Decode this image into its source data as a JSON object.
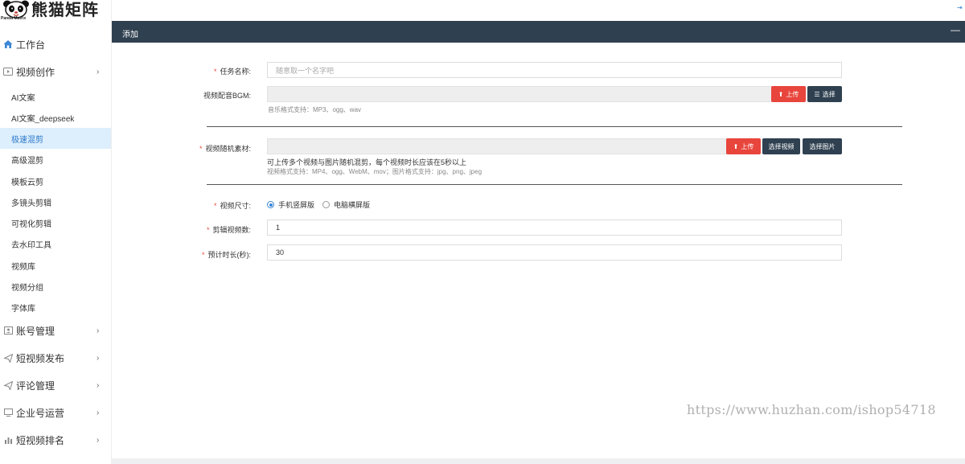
{
  "brand": {
    "name": "熊猫矩阵",
    "sub": "Panda Matrix"
  },
  "sidebar": {
    "items": [
      {
        "label": "工作台",
        "icon": "home-icon"
      },
      {
        "label": "视频创作",
        "icon": "video-icon",
        "expanded": true,
        "children": [
          {
            "label": "AI文案"
          },
          {
            "label": "AI文案_deepseek"
          },
          {
            "label": "极速混剪",
            "active": true
          },
          {
            "label": "高级混剪"
          },
          {
            "label": "模板云剪"
          },
          {
            "label": "多镜头剪辑"
          },
          {
            "label": "可视化剪辑"
          },
          {
            "label": "去水印工具"
          },
          {
            "label": "视频库"
          },
          {
            "label": "视频分组"
          },
          {
            "label": "字体库"
          }
        ]
      },
      {
        "label": "账号管理",
        "icon": "account-icon"
      },
      {
        "label": "短视频发布",
        "icon": "send-icon"
      },
      {
        "label": "评论管理",
        "icon": "comment-icon"
      },
      {
        "label": "企业号运营",
        "icon": "enterprise-icon"
      },
      {
        "label": "短视频排名",
        "icon": "chart-icon"
      }
    ]
  },
  "panel": {
    "title": "添加",
    "collapse": "—"
  },
  "form": {
    "task_name": {
      "label": "任务名称:",
      "placeholder": "随意取一个名字吧",
      "required": true
    },
    "bgm": {
      "label": "视频配音BGM:",
      "upload": "上传",
      "select": "选择",
      "help": "音乐格式支持：MP3、ogg、wav"
    },
    "material": {
      "label": "视频随机素材:",
      "required": true,
      "upload": "上传",
      "select_video": "选择视频",
      "select_image": "选择图片",
      "help1": "可上传多个视频与图片随机混剪，每个视频时长应该在5秒以上",
      "help2": "视频格式支持：MP4、ogg、WebM、mov；图片格式支持：jpg、png、jpeg"
    },
    "size": {
      "label": "视频尺寸:",
      "required": true,
      "options": [
        "手机竖屏版",
        "电脑横屏版"
      ],
      "selected": "手机竖屏版"
    },
    "count": {
      "label": "剪辑视频数:",
      "required": true,
      "value": "1"
    },
    "duration": {
      "label": "预计时长(秒):",
      "required": true,
      "value": "30"
    }
  },
  "watermark": "https://www.huzhan.com/ishop54718",
  "colors": {
    "sidebar_header": "#2f4050",
    "danger": "#e8453c",
    "accent": "#3b86d6",
    "active_bg": "#ddeefc"
  }
}
